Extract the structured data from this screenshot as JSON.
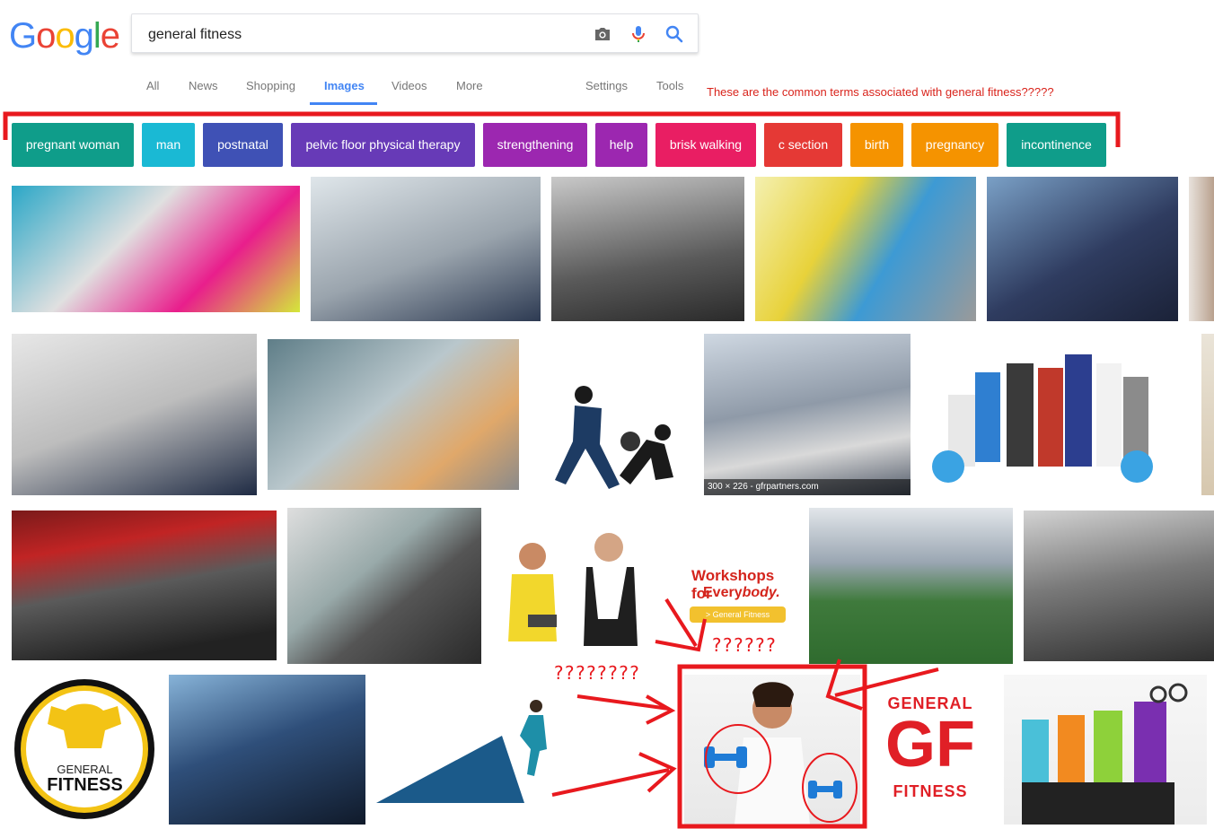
{
  "search": {
    "value": "general fitness"
  },
  "logo": [
    "G",
    "o",
    "o",
    "g",
    "l",
    "e"
  ],
  "tabs": {
    "all": "All",
    "news": "News",
    "shopping": "Shopping",
    "images": "Images",
    "videos": "Videos",
    "more": "More",
    "settings": "Settings",
    "tools": "Tools"
  },
  "annotation": {
    "top_note": "These are the common terms associated with general fitness?????",
    "q_left": "????????",
    "q_right": "??????"
  },
  "chips": [
    {
      "label": "pregnant woman",
      "color": "#0f9d8a"
    },
    {
      "label": "man",
      "color": "#1ab9d4"
    },
    {
      "label": "postnatal",
      "color": "#3f51b5"
    },
    {
      "label": "pelvic floor physical therapy",
      "color": "#673ab7"
    },
    {
      "label": "strengthening",
      "color": "#9c27b0"
    },
    {
      "label": "help",
      "color": "#9c27b0"
    },
    {
      "label": "brisk walking",
      "color": "#e91e63"
    },
    {
      "label": "c section",
      "color": "#e53935"
    },
    {
      "label": "birth",
      "color": "#f59300"
    },
    {
      "label": "pregnancy",
      "color": "#f59300"
    },
    {
      "label": "incontinence",
      "color": "#0f9d8a"
    }
  ],
  "image_caption": "300 × 226 - gfrpartners.com",
  "ad": {
    "headline_1": "Workshops for",
    "headline_2": "Every",
    "headline_3": "body.",
    "button": "> General Fitness"
  },
  "logo_badge": {
    "line1": "GENERAL",
    "line2": "FITNESS"
  },
  "gf_logo": {
    "top": "GENERAL",
    "letters": "GF",
    "bottom": "FITNESS"
  }
}
